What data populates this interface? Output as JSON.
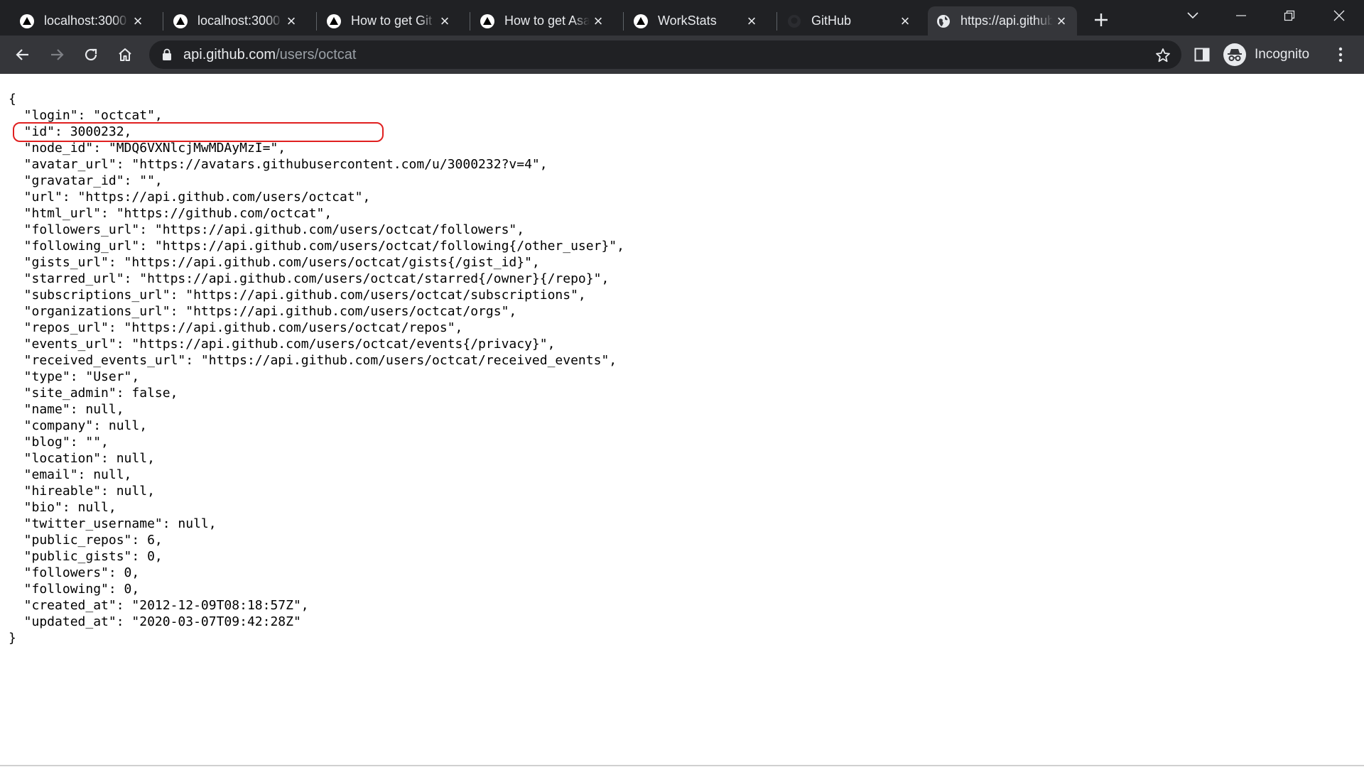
{
  "browser": {
    "tabs": [
      {
        "title": "localhost:3000",
        "favicon": "triangle-logo-icon",
        "active": false
      },
      {
        "title": "localhost:3000",
        "favicon": "triangle-logo-icon",
        "active": false
      },
      {
        "title": "How to get Git",
        "favicon": "triangle-logo-icon",
        "active": false
      },
      {
        "title": "How to get Asa",
        "favicon": "triangle-logo-icon",
        "active": false
      },
      {
        "title": "WorkStats",
        "favicon": "triangle-logo-icon",
        "active": false
      },
      {
        "title": "GitHub",
        "favicon": "github-logo-icon",
        "active": false
      },
      {
        "title": "https://api.github",
        "favicon": "globe-icon",
        "active": true
      }
    ],
    "address_bar": {
      "host": "api.github.com",
      "path": "/users/octcat"
    },
    "profile_label": "Incognito",
    "colors": {
      "tabstrip": "#202124",
      "toolbar": "#35363a",
      "omnibox": "#202124",
      "highlight": "#e02020"
    }
  },
  "json_view": {
    "open": "{",
    "close": "}",
    "lines": [
      "  \"login\": \"octcat\",",
      "  \"id\": 3000232,",
      "  \"node_id\": \"MDQ6VXNlcjMwMDAyMzI=\",",
      "  \"avatar_url\": \"https://avatars.githubusercontent.com/u/3000232?v=4\",",
      "  \"gravatar_id\": \"\",",
      "  \"url\": \"https://api.github.com/users/octcat\",",
      "  \"html_url\": \"https://github.com/octcat\",",
      "  \"followers_url\": \"https://api.github.com/users/octcat/followers\",",
      "  \"following_url\": \"https://api.github.com/users/octcat/following{/other_user}\",",
      "  \"gists_url\": \"https://api.github.com/users/octcat/gists{/gist_id}\",",
      "  \"starred_url\": \"https://api.github.com/users/octcat/starred{/owner}{/repo}\",",
      "  \"subscriptions_url\": \"https://api.github.com/users/octcat/subscriptions\",",
      "  \"organizations_url\": \"https://api.github.com/users/octcat/orgs\",",
      "  \"repos_url\": \"https://api.github.com/users/octcat/repos\",",
      "  \"events_url\": \"https://api.github.com/users/octcat/events{/privacy}\",",
      "  \"received_events_url\": \"https://api.github.com/users/octcat/received_events\",",
      "  \"type\": \"User\",",
      "  \"site_admin\": false,",
      "  \"name\": null,",
      "  \"company\": null,",
      "  \"blog\": \"\",",
      "  \"location\": null,",
      "  \"email\": null,",
      "  \"hireable\": null,",
      "  \"bio\": null,",
      "  \"twitter_username\": null,",
      "  \"public_repos\": 6,",
      "  \"public_gists\": 0,",
      "  \"followers\": 0,",
      "  \"following\": 0,",
      "  \"created_at\": \"2012-12-09T08:18:57Z\",",
      "  \"updated_at\": \"2020-03-07T09:42:28Z\""
    ]
  }
}
